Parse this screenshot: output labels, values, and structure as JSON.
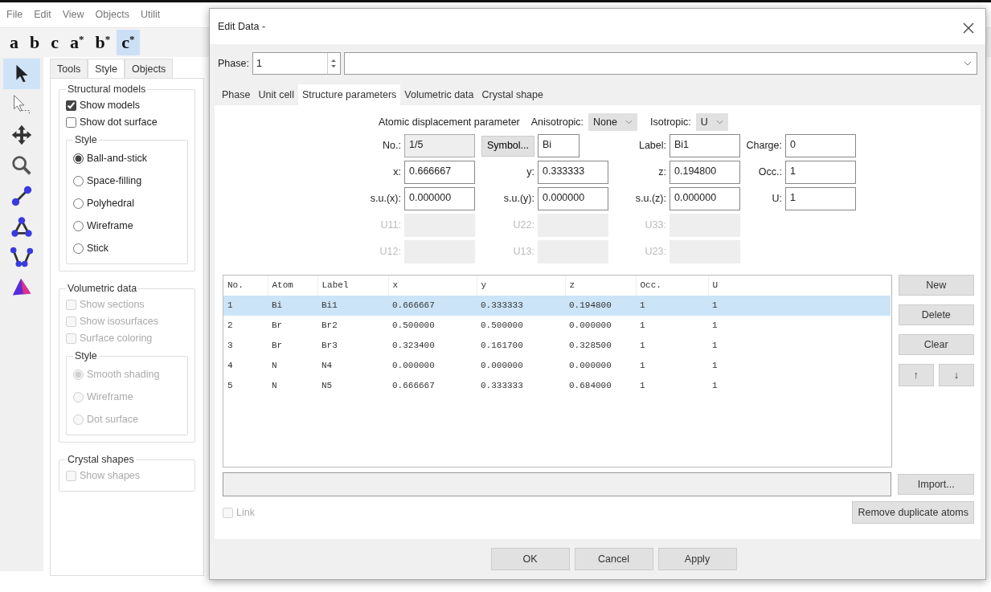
{
  "menu": [
    "File",
    "Edit",
    "View",
    "Objects",
    "Utilit"
  ],
  "axis_buttons": [
    {
      "label": "a",
      "selected": false
    },
    {
      "label": "b",
      "selected": false
    },
    {
      "label": "c",
      "selected": false
    },
    {
      "label": "a$^{*}$",
      "selected": false
    },
    {
      "label": "b$^{*}$",
      "selected": false
    },
    {
      "label": "c$^{*}$",
      "selected": true
    }
  ],
  "tools": [
    {
      "kind": "pointer",
      "selected": true
    },
    {
      "kind": "select",
      "selected": false
    },
    {
      "kind": "move",
      "selected": false
    },
    {
      "kind": "zoom",
      "selected": false
    },
    {
      "kind": "bond",
      "selected": false
    },
    {
      "kind": "angle",
      "selected": false
    },
    {
      "kind": "dihedral",
      "selected": false
    },
    {
      "kind": "polyhedron",
      "selected": false
    }
  ],
  "panel_tabs": [
    {
      "label": "Tools",
      "selected": false
    },
    {
      "label": "Style",
      "selected": true
    },
    {
      "label": "Objects",
      "selected": false
    }
  ],
  "groups": [
    {
      "title": "Structural models",
      "checkboxes": [
        {
          "label": "Show models",
          "checked": true,
          "disabled": false
        },
        {
          "label": "Show dot surface",
          "checked": false,
          "disabled": false
        }
      ],
      "style": {
        "title": "Style",
        "radios": [
          {
            "label": "Ball-and-stick",
            "selected": true,
            "disabled": false
          },
          {
            "label": "Space-filling",
            "selected": false,
            "disabled": false
          },
          {
            "label": "Polyhedral",
            "selected": false,
            "disabled": false
          },
          {
            "label": "Wireframe",
            "selected": false,
            "disabled": false
          },
          {
            "label": "Stick",
            "selected": false,
            "disabled": false
          }
        ]
      }
    },
    {
      "title": "Volumetric data",
      "checkboxes": [
        {
          "label": "Show sections",
          "checked": false,
          "disabled": true
        },
        {
          "label": "Show isosurfaces",
          "checked": false,
          "disabled": true
        },
        {
          "label": "Surface coloring",
          "checked": false,
          "disabled": true
        }
      ],
      "style": {
        "title": "Style",
        "radios": [
          {
            "label": "Smooth shading",
            "selected": true,
            "disabled": true
          },
          {
            "label": "Wireframe",
            "selected": false,
            "disabled": true
          },
          {
            "label": "Dot surface",
            "selected": false,
            "disabled": true
          }
        ]
      }
    },
    {
      "title": "Crystal shapes",
      "checkboxes": [
        {
          "label": "Show shapes",
          "checked": false,
          "disabled": true
        }
      ]
    }
  ],
  "dialog": {
    "title": "Edit Data -",
    "phase_label": "Phase:",
    "phase_value": "1",
    "tabs": [
      {
        "label": "Phase",
        "selected": false
      },
      {
        "label": "Unit cell",
        "selected": false
      },
      {
        "label": "Structure parameters",
        "selected": true
      },
      {
        "label": "Volumetric data",
        "selected": false
      },
      {
        "label": "Crystal shape",
        "selected": false
      }
    ],
    "adp": {
      "title": "Atomic displacement parameter",
      "anisotropic_label": "Anisotropic:",
      "anisotropic_value": "None",
      "isotropic_label": "Isotropic:",
      "isotropic_value": "U"
    },
    "field_rows": [
      [
        {
          "kind": "field",
          "label": "No.:",
          "value": "1/5",
          "readonly": true
        },
        {
          "kind": "symbol",
          "button": "Symbol...",
          "value": "Bi"
        },
        {
          "kind": "field",
          "label": "Label:",
          "value": "Bi1",
          "readonly": false
        },
        {
          "kind": "field",
          "label": "Charge:",
          "value": "0",
          "readonly": false
        }
      ],
      [
        {
          "kind": "field",
          "label": "x:",
          "value": "0.666667",
          "readonly": false
        },
        {
          "kind": "field",
          "label": "y:",
          "value": "0.333333",
          "readonly": false
        },
        {
          "kind": "field",
          "label": "z:",
          "value": "0.194800",
          "readonly": false
        },
        {
          "kind": "field",
          "label": "Occ.:",
          "value": "1",
          "readonly": false
        }
      ],
      [
        {
          "kind": "field",
          "label": "s.u.(x):",
          "value": "0.000000",
          "readonly": false
        },
        {
          "kind": "field",
          "label": "s.u.(y):",
          "value": "0.000000",
          "readonly": false
        },
        {
          "kind": "field",
          "label": "s.u.(z):",
          "value": "0.000000",
          "readonly": false
        },
        {
          "kind": "field",
          "label": "U:",
          "value": "1",
          "readonly": false
        }
      ],
      [
        {
          "kind": "disabled",
          "label": "U11:"
        },
        {
          "kind": "disabled",
          "label": "U22:"
        },
        {
          "kind": "disabled",
          "label": "U33:"
        }
      ],
      [
        {
          "kind": "disabled",
          "label": "U12:"
        },
        {
          "kind": "disabled",
          "label": "U13:"
        },
        {
          "kind": "disabled",
          "label": "U23:"
        }
      ]
    ],
    "table": {
      "columns": [
        "No.",
        "Atom",
        "Label",
        "x",
        "y",
        "z",
        "Occ.",
        "U"
      ],
      "rows": [
        {
          "cells": [
            "1",
            "Bi",
            "Bi1",
            "0.666667",
            "0.333333",
            "0.194800",
            "1",
            "1"
          ],
          "selected": true
        },
        {
          "cells": [
            "2",
            "Br",
            "Br2",
            "0.500000",
            "0.500000",
            "0.000000",
            "1",
            "1"
          ],
          "selected": false
        },
        {
          "cells": [
            "3",
            "Br",
            "Br3",
            "0.323400",
            "0.161700",
            "0.328500",
            "1",
            "1"
          ],
          "selected": false
        },
        {
          "cells": [
            "4",
            "N",
            "N4",
            "0.000000",
            "0.000000",
            "0.000000",
            "1",
            "1"
          ],
          "selected": false
        },
        {
          "cells": [
            "5",
            "N",
            "N5",
            "0.666667",
            "0.333333",
            "0.684000",
            "1",
            "1"
          ],
          "selected": false
        }
      ]
    },
    "side_buttons": [
      "New",
      "Delete",
      "Clear"
    ],
    "up_button": "↑",
    "down_button": "↓",
    "import_button": "Import...",
    "link": {
      "label": "Link",
      "checked": false,
      "disabled": true
    },
    "remove_button": "Remove duplicate atoms",
    "footer_buttons": [
      "OK",
      "Cancel",
      "Apply"
    ]
  }
}
